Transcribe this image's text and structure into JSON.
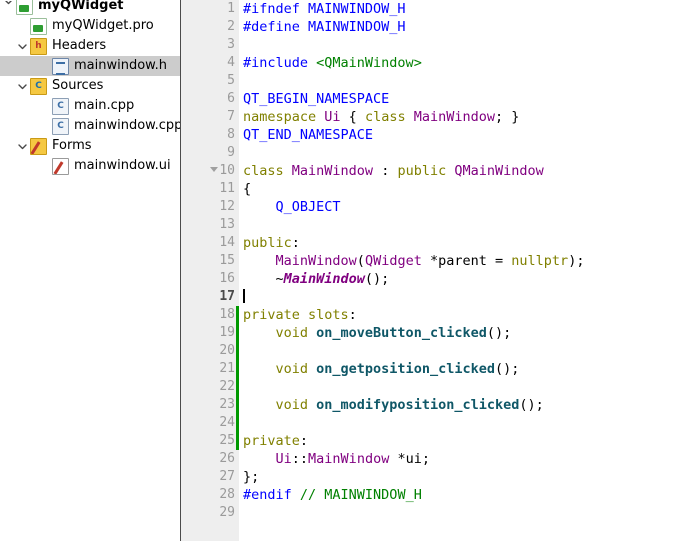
{
  "sidebar": {
    "name": "project-tree",
    "items": [
      {
        "label": "myQWidget",
        "icon": "project-icon",
        "depth": 0,
        "twisty": "expanded-partial",
        "bold": true,
        "selected": false
      },
      {
        "label": "myQWidget.pro",
        "icon": "pro-file-icon",
        "depth": 1,
        "twisty": "none",
        "bold": false,
        "selected": false
      },
      {
        "label": "Headers",
        "icon": "headers-folder-icon",
        "depth": 1,
        "twisty": "expanded",
        "bold": false,
        "selected": false
      },
      {
        "label": "mainwindow.h",
        "icon": "header-file-icon",
        "depth": 2,
        "twisty": "none",
        "bold": false,
        "selected": true
      },
      {
        "label": "Sources",
        "icon": "sources-folder-icon",
        "depth": 1,
        "twisty": "expanded",
        "bold": false,
        "selected": false
      },
      {
        "label": "main.cpp",
        "icon": "cpp-file-icon",
        "depth": 2,
        "twisty": "none",
        "bold": false,
        "selected": false
      },
      {
        "label": "mainwindow.cpp",
        "icon": "cpp-file-icon",
        "depth": 2,
        "twisty": "none",
        "bold": false,
        "selected": false
      },
      {
        "label": "Forms",
        "icon": "forms-folder-icon",
        "depth": 1,
        "twisty": "expanded",
        "bold": false,
        "selected": false
      },
      {
        "label": "mainwindow.ui",
        "icon": "ui-file-icon",
        "depth": 2,
        "twisty": "none",
        "bold": false,
        "selected": false
      }
    ]
  },
  "editor": {
    "name": "code-editor",
    "filename": "mainwindow.h",
    "language": "C++",
    "current_line": 17,
    "total_lines": 29,
    "fold_marker_line": 10,
    "change_bar_lines": [
      18,
      19,
      20,
      21,
      22,
      23,
      24,
      25
    ],
    "colors": {
      "gutter_background": "#eeeeee",
      "line_number": "#9a9a9a",
      "current_line_number": "#4a4a4a",
      "change_bar": "#009900",
      "editor_background": "#ffffff",
      "preprocessor": "#0000ff",
      "keyword": "#808000",
      "type": "#800080",
      "string": "#008000",
      "comment": "#008000",
      "function": "#0f5767",
      "text": "#000000",
      "selection": "#cccccc",
      "splitter": "#4a4a4a"
    },
    "lines": [
      {
        "n": 1,
        "tokens": [
          {
            "t": "#ifndef ",
            "c": "t-pre"
          },
          {
            "t": "MAINWINDOW_H",
            "c": "t-macro"
          }
        ]
      },
      {
        "n": 2,
        "tokens": [
          {
            "t": "#define ",
            "c": "t-pre"
          },
          {
            "t": "MAINWINDOW_H",
            "c": "t-macro"
          }
        ]
      },
      {
        "n": 3,
        "tokens": []
      },
      {
        "n": 4,
        "tokens": [
          {
            "t": "#include ",
            "c": "t-pre"
          },
          {
            "t": "<QMainWindow>",
            "c": "t-string"
          }
        ]
      },
      {
        "n": 5,
        "tokens": []
      },
      {
        "n": 6,
        "tokens": [
          {
            "t": "QT_BEGIN_NAMESPACE",
            "c": "t-macro"
          }
        ]
      },
      {
        "n": 7,
        "tokens": [
          {
            "t": "namespace ",
            "c": "t-kw"
          },
          {
            "t": "Ui",
            "c": "t-type"
          },
          {
            "t": " { ",
            "c": "t-plain"
          },
          {
            "t": "class ",
            "c": "t-kw"
          },
          {
            "t": "MainWindow",
            "c": "t-type"
          },
          {
            "t": "; }",
            "c": "t-plain"
          }
        ]
      },
      {
        "n": 8,
        "tokens": [
          {
            "t": "QT_END_NAMESPACE",
            "c": "t-macro"
          }
        ]
      },
      {
        "n": 9,
        "tokens": []
      },
      {
        "n": 10,
        "tokens": [
          {
            "t": "class ",
            "c": "t-kw"
          },
          {
            "t": "MainWindow",
            "c": "t-type"
          },
          {
            "t": " : ",
            "c": "t-plain"
          },
          {
            "t": "public ",
            "c": "t-kw"
          },
          {
            "t": "QMainWindow",
            "c": "t-type"
          }
        ]
      },
      {
        "n": 11,
        "tokens": [
          {
            "t": "{",
            "c": "t-plain"
          }
        ]
      },
      {
        "n": 12,
        "tokens": [
          {
            "t": "    ",
            "c": "t-plain"
          },
          {
            "t": "Q_OBJECT",
            "c": "t-macro"
          }
        ]
      },
      {
        "n": 13,
        "tokens": []
      },
      {
        "n": 14,
        "tokens": [
          {
            "t": "public",
            "c": "t-kw"
          },
          {
            "t": ":",
            "c": "t-plain"
          }
        ]
      },
      {
        "n": 15,
        "tokens": [
          {
            "t": "    ",
            "c": "t-plain"
          },
          {
            "t": "MainWindow",
            "c": "t-type"
          },
          {
            "t": "(",
            "c": "t-plain"
          },
          {
            "t": "QWidget",
            "c": "t-type"
          },
          {
            "t": " *",
            "c": "t-plain"
          },
          {
            "t": "parent",
            "c": "t-field"
          },
          {
            "t": " = ",
            "c": "t-plain"
          },
          {
            "t": "nullptr",
            "c": "t-kw"
          },
          {
            "t": ");",
            "c": "t-plain"
          }
        ]
      },
      {
        "n": 16,
        "tokens": [
          {
            "t": "    ~",
            "c": "t-plain"
          },
          {
            "t": "MainWindow",
            "c": "t-virtual"
          },
          {
            "t": "();",
            "c": "t-plain"
          }
        ]
      },
      {
        "n": 17,
        "tokens": [],
        "cursor": true
      },
      {
        "n": 18,
        "tokens": [
          {
            "t": "private slots",
            "c": "t-kw"
          },
          {
            "t": ":",
            "c": "t-plain"
          }
        ]
      },
      {
        "n": 19,
        "tokens": [
          {
            "t": "    ",
            "c": "t-plain"
          },
          {
            "t": "void ",
            "c": "t-kw"
          },
          {
            "t": "on_moveButton_clicked",
            "c": "t-func"
          },
          {
            "t": "();",
            "c": "t-plain"
          }
        ]
      },
      {
        "n": 20,
        "tokens": []
      },
      {
        "n": 21,
        "tokens": [
          {
            "t": "    ",
            "c": "t-plain"
          },
          {
            "t": "void ",
            "c": "t-kw"
          },
          {
            "t": "on_getposition_clicked",
            "c": "t-func"
          },
          {
            "t": "();",
            "c": "t-plain"
          }
        ]
      },
      {
        "n": 22,
        "tokens": []
      },
      {
        "n": 23,
        "tokens": [
          {
            "t": "    ",
            "c": "t-plain"
          },
          {
            "t": "void ",
            "c": "t-kw"
          },
          {
            "t": "on_modifyposition_clicked",
            "c": "t-func"
          },
          {
            "t": "();",
            "c": "t-plain"
          }
        ]
      },
      {
        "n": 24,
        "tokens": []
      },
      {
        "n": 25,
        "tokens": [
          {
            "t": "private",
            "c": "t-kw"
          },
          {
            "t": ":",
            "c": "t-plain"
          }
        ]
      },
      {
        "n": 26,
        "tokens": [
          {
            "t": "    ",
            "c": "t-plain"
          },
          {
            "t": "Ui",
            "c": "t-type"
          },
          {
            "t": "::",
            "c": "t-plain"
          },
          {
            "t": "MainWindow",
            "c": "t-type"
          },
          {
            "t": " *",
            "c": "t-plain"
          },
          {
            "t": "ui",
            "c": "t-field"
          },
          {
            "t": ";",
            "c": "t-plain"
          }
        ]
      },
      {
        "n": 27,
        "tokens": [
          {
            "t": "};",
            "c": "t-plain"
          }
        ]
      },
      {
        "n": 28,
        "tokens": [
          {
            "t": "#endif ",
            "c": "t-pre"
          },
          {
            "t": "// MAINWINDOW_H",
            "c": "t-comment"
          }
        ]
      },
      {
        "n": 29,
        "tokens": []
      }
    ]
  }
}
